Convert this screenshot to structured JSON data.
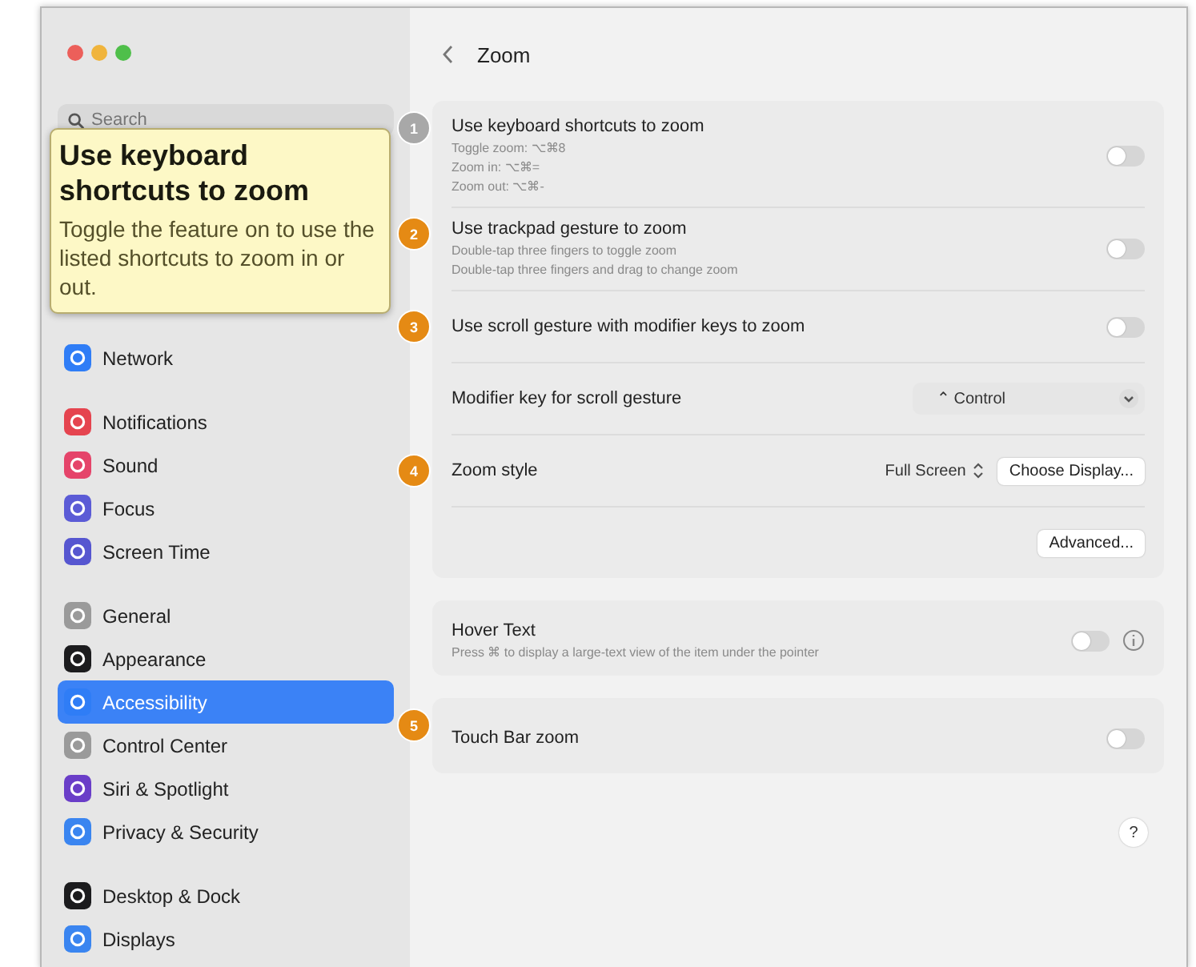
{
  "window": {
    "traffic_lights": [
      {
        "color": "#ec5f5a"
      },
      {
        "color": "#f0b43c"
      },
      {
        "color": "#4fbf4a"
      }
    ]
  },
  "sidebar": {
    "search": {
      "placeholder": "Search"
    },
    "groups": [
      [
        {
          "label": "Network",
          "color": "#2f7df6",
          "selected": false
        }
      ],
      [
        {
          "label": "Notifications",
          "color": "#e5444f",
          "selected": false
        },
        {
          "label": "Sound",
          "color": "#e5446a",
          "selected": false
        },
        {
          "label": "Focus",
          "color": "#5b5bd6",
          "selected": false
        },
        {
          "label": "Screen Time",
          "color": "#5656d0",
          "selected": false
        }
      ],
      [
        {
          "label": "General",
          "color": "#9a9a9a",
          "selected": false
        },
        {
          "label": "Appearance",
          "color": "#1c1c1e",
          "selected": false
        },
        {
          "label": "Accessibility",
          "color": "#2f7df6",
          "selected": true
        },
        {
          "label": "Control Center",
          "color": "#9a9a9a",
          "selected": false
        },
        {
          "label": "Siri & Spotlight",
          "color": "#6a3ec8",
          "selected": false
        },
        {
          "label": "Privacy & Security",
          "color": "#3a85f0",
          "selected": false
        }
      ],
      [
        {
          "label": "Desktop & Dock",
          "color": "#1c1c1e",
          "selected": false
        },
        {
          "label": "Displays",
          "color": "#3a85f0",
          "selected": false
        }
      ]
    ]
  },
  "header": {
    "title": "Zoom"
  },
  "cards": [
    {
      "rows": [
        {
          "kind": "toggle",
          "title": "Use keyboard shortcuts to zoom",
          "subtitles": [
            "Toggle zoom: ⌥⌘8",
            "Zoom in: ⌥⌘=",
            "Zoom out: ⌥⌘-"
          ],
          "on": false,
          "callout": {
            "number": "1",
            "selected": true
          }
        },
        {
          "kind": "toggle",
          "title": "Use trackpad gesture to zoom",
          "subtitles": [
            "Double-tap three fingers to toggle zoom",
            "Double-tap three fingers and drag to change zoom"
          ],
          "on": false,
          "callout": {
            "number": "2",
            "selected": false
          }
        },
        {
          "kind": "toggle",
          "title": "Use scroll gesture with modifier keys to zoom",
          "on": false,
          "callout": {
            "number": "3",
            "selected": false
          }
        },
        {
          "kind": "select",
          "title": "Modifier key for scroll gesture",
          "value": "⌃ Control"
        },
        {
          "kind": "style",
          "title": "Zoom style",
          "value": "Full Screen",
          "button": "Choose Display...",
          "callout": {
            "number": "4",
            "selected": false
          }
        },
        {
          "kind": "button",
          "button": "Advanced..."
        }
      ]
    },
    {
      "rows": [
        {
          "kind": "toggle",
          "title": "Hover Text",
          "subtitles": [
            "Press ⌘ to display a large-text view of the item under the pointer"
          ],
          "on": false,
          "info": true
        }
      ]
    },
    {
      "rows": [
        {
          "kind": "toggle",
          "title": "Touch Bar zoom",
          "on": false,
          "callout": {
            "number": "5",
            "selected": false
          }
        }
      ]
    }
  ],
  "help": {
    "label": "?"
  },
  "tooltip": {
    "title": "Use keyboard shortcuts to zoom",
    "body": "Toggle the feature on to use the listed shortcuts to zoom in or out."
  }
}
